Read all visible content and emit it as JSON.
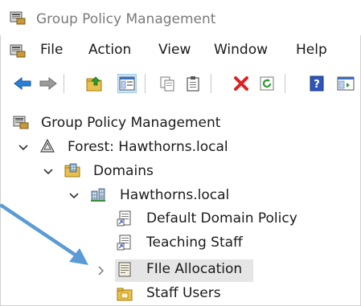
{
  "window": {
    "title": "Group Policy Management"
  },
  "menu": {
    "items": [
      "File",
      "Action",
      "View",
      "Window",
      "Help"
    ]
  },
  "toolbar": {
    "buttons": [
      "back-icon",
      "forward-icon",
      "up-folder-icon",
      "show-hide-console-tree-icon",
      "copy-icon",
      "paste-icon",
      "delete-icon",
      "refresh-icon",
      "help-icon",
      "properties-icon"
    ]
  },
  "tree": {
    "root": "Group Policy Management",
    "forest": "Forest: Hawthorns.local",
    "domains": "Domains",
    "domain": "Hawthorns.local",
    "items": [
      "Default Domain Policy",
      "Teaching Staff",
      "FIle Allocation",
      "Staff Users"
    ]
  },
  "colors": {
    "arrow": "#5b9bd5",
    "selected_background": "#e5e5e5",
    "delete_red": "#e02020",
    "back_blue": "#2a7fd4"
  }
}
